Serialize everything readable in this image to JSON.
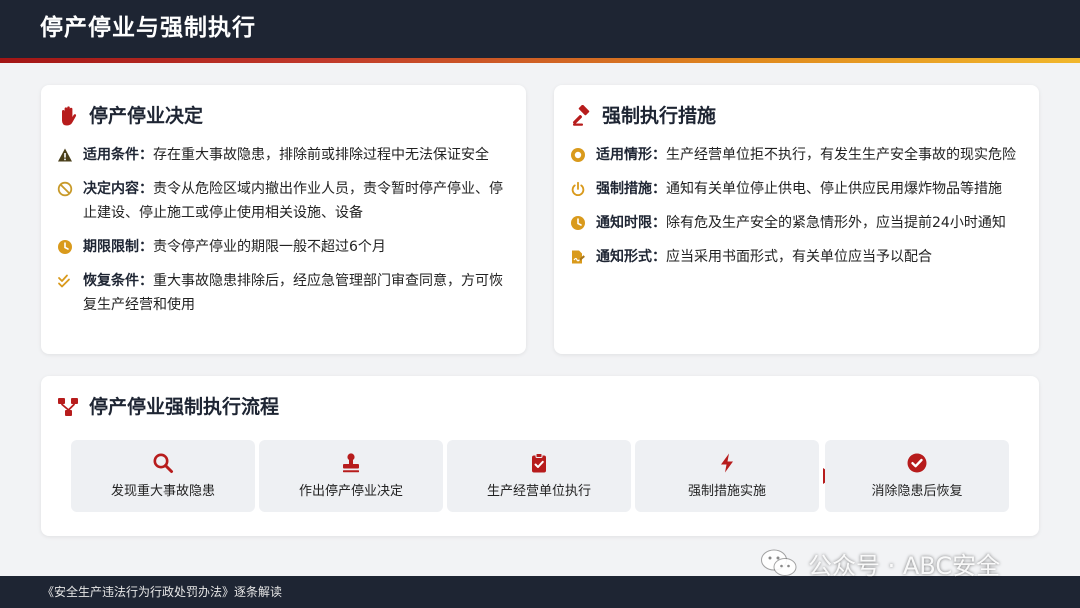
{
  "header": {
    "title": "停产停业与强制执行"
  },
  "colors": {
    "accent_red": "#b71c1c",
    "accent_orange": "#e0a020",
    "navy": "#1e2533"
  },
  "left_card": {
    "title": "停产停业决定",
    "icon": "hand-stop-icon",
    "items": [
      {
        "icon": "warning-icon",
        "label": "适用条件：",
        "text": "存在重大事故隐患，排除前或排除过程中无法保证安全"
      },
      {
        "icon": "ban-icon",
        "label": "决定内容：",
        "text": "责令从危险区域内撤出作业人员，责令暂时停产停业、停止建设、停止施工或停止使用相关设施、设备"
      },
      {
        "icon": "clock-icon",
        "label": "期限限制：",
        "text": "责令停产停业的期限一般不超过6个月"
      },
      {
        "icon": "double-check-icon",
        "label": "恢复条件：",
        "text": "重大事故隐患排除后，经应急管理部门审查同意，方可恢复生产经营和使用"
      }
    ]
  },
  "right_card": {
    "title": "强制执行措施",
    "icon": "gavel-icon",
    "items": [
      {
        "icon": "ring-icon",
        "label": "适用情形：",
        "text": "生产经营单位拒不执行，有发生生产安全事故的现实危险"
      },
      {
        "icon": "power-icon",
        "label": "强制措施：",
        "text": "通知有关单位停止供电、停止供应民用爆炸物品等措施"
      },
      {
        "icon": "clock-icon",
        "label": "通知时限：",
        "text": "除有危及生产安全的紧急情形外，应当提前24小时通知"
      },
      {
        "icon": "file-signature-icon",
        "label": "通知形式：",
        "text": "应当采用书面形式，有关单位应当予以配合"
      }
    ]
  },
  "flow": {
    "title": "停产停业强制执行流程",
    "icon": "flow-nodes-icon",
    "steps": [
      {
        "icon": "search-icon",
        "label": "发现重大事故隐患"
      },
      {
        "icon": "stamp-icon",
        "label": "作出停产停业决定"
      },
      {
        "icon": "clipboard-check-icon",
        "label": "生产经营单位执行"
      },
      {
        "icon": "bolt-icon",
        "label": "强制措施实施"
      },
      {
        "icon": "check-circle-icon",
        "label": "消除隐患后恢复"
      }
    ]
  },
  "footer": {
    "text": "《安全生产违法行为行政处罚办法》逐条解读"
  },
  "watermark": {
    "text": "公众号 · ABC安全"
  }
}
